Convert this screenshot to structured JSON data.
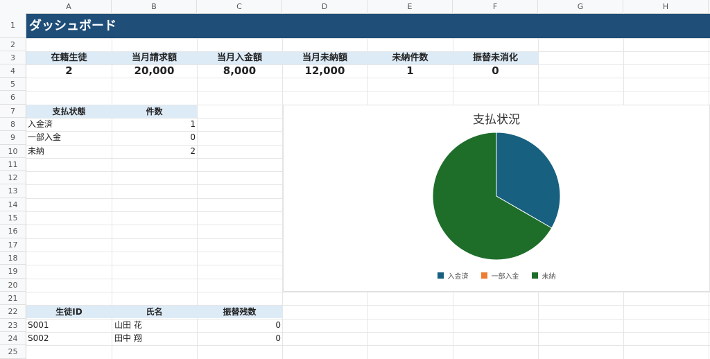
{
  "columns": [
    "A",
    "B",
    "C",
    "D",
    "E",
    "F",
    "G",
    "H"
  ],
  "rows": [
    "1",
    "2",
    "3",
    "4",
    "5",
    "6",
    "7",
    "8",
    "9",
    "10",
    "11",
    "12",
    "13",
    "14",
    "15",
    "16",
    "17",
    "18",
    "19",
    "20",
    "21",
    "22",
    "23",
    "24",
    "25"
  ],
  "banner": "ダッシュボード",
  "kpis": [
    {
      "label": "在籍生徒",
      "value": "2"
    },
    {
      "label": "当月請求額",
      "value": "20,000"
    },
    {
      "label": "当月入金額",
      "value": "8,000"
    },
    {
      "label": "当月未納額",
      "value": "12,000"
    },
    {
      "label": "未納件数",
      "value": "1"
    },
    {
      "label": "振替未消化",
      "value": "0"
    }
  ],
  "status_table": {
    "headers": [
      "支払状態",
      "件数"
    ],
    "rows": [
      {
        "label": "入金済",
        "count": "1"
      },
      {
        "label": "一部入金",
        "count": "0"
      },
      {
        "label": "未納",
        "count": "2"
      }
    ]
  },
  "student_table": {
    "headers": [
      "生徒ID",
      "氏名",
      "振替残数"
    ],
    "rows": [
      {
        "id": "S001",
        "name": "山田 花",
        "remain": "0"
      },
      {
        "id": "S002",
        "name": "田中 翔",
        "remain": "0"
      }
    ]
  },
  "chart_data": {
    "type": "pie",
    "title": "支払状況",
    "categories": [
      "入金済",
      "一部入金",
      "未納"
    ],
    "values": [
      1,
      0,
      2
    ],
    "colors": [
      "#17607f",
      "#ed7d31",
      "#1e6e2a"
    ],
    "legend": "bottom"
  }
}
